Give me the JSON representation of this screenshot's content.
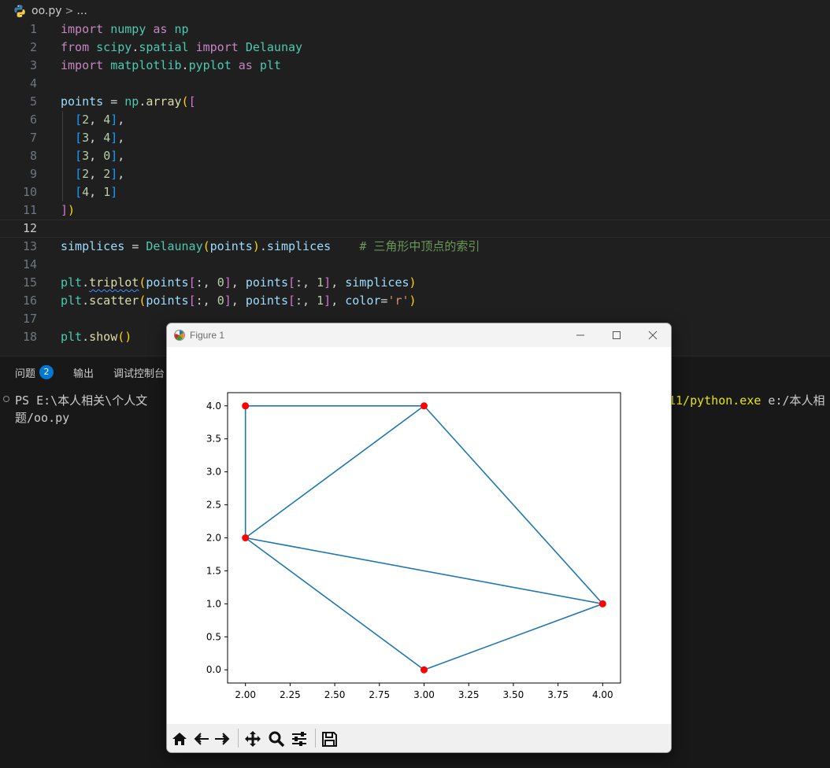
{
  "breadcrumb": {
    "file": "oo.py",
    "separator": ">",
    "more": "..."
  },
  "editor": {
    "current_line": 12,
    "comment": "# 三角形中顶点的索引",
    "lines": [
      {
        "n": "1"
      },
      {
        "n": "2"
      },
      {
        "n": "3"
      },
      {
        "n": "4"
      },
      {
        "n": "5"
      },
      {
        "n": "6"
      },
      {
        "n": "7"
      },
      {
        "n": "8"
      },
      {
        "n": "9"
      },
      {
        "n": "10"
      },
      {
        "n": "11"
      },
      {
        "n": "12"
      },
      {
        "n": "13"
      },
      {
        "n": "14"
      },
      {
        "n": "15"
      },
      {
        "n": "16"
      },
      {
        "n": "17"
      },
      {
        "n": "18"
      }
    ]
  },
  "panel": {
    "tabs": [
      {
        "label": "问题",
        "badge": "2"
      },
      {
        "label": "输出"
      },
      {
        "label": "调试控制台"
      }
    ],
    "terminal": {
      "prompt_start": "PS E:\\本人相关\\个人文",
      "exe_fragment": "11/python.exe",
      "path_fragment": " e:/本人相",
      "line2": "题/oo.py"
    }
  },
  "figure": {
    "title": "Figure 1",
    "toolbar": [
      "home-icon",
      "back-icon",
      "forward-icon",
      "pan-icon",
      "zoom-icon",
      "configure-subplots-icon",
      "save-icon"
    ]
  },
  "colors": {
    "line": "#1f77b4",
    "points": "#ff0000",
    "accent": "#0078d4"
  },
  "chart_data": {
    "type": "line",
    "title": "",
    "xlabel": "",
    "ylabel": "",
    "points": [
      [
        2,
        4
      ],
      [
        3,
        4
      ],
      [
        3,
        0
      ],
      [
        2,
        2
      ],
      [
        4,
        1
      ]
    ],
    "edges": [
      [
        0,
        1
      ],
      [
        0,
        3
      ],
      [
        1,
        3
      ],
      [
        1,
        4
      ],
      [
        3,
        4
      ],
      [
        3,
        2
      ],
      [
        2,
        4
      ]
    ],
    "xlim": [
      1.9,
      4.1
    ],
    "ylim": [
      -0.2,
      4.2
    ],
    "xticks": [
      "2.00",
      "2.25",
      "2.50",
      "2.75",
      "3.00",
      "3.25",
      "3.50",
      "3.75",
      "4.00"
    ],
    "yticks": [
      "0.0",
      "0.5",
      "1.0",
      "1.5",
      "2.0",
      "2.5",
      "3.0",
      "3.5",
      "4.0"
    ],
    "grid": false,
    "legend": false
  }
}
